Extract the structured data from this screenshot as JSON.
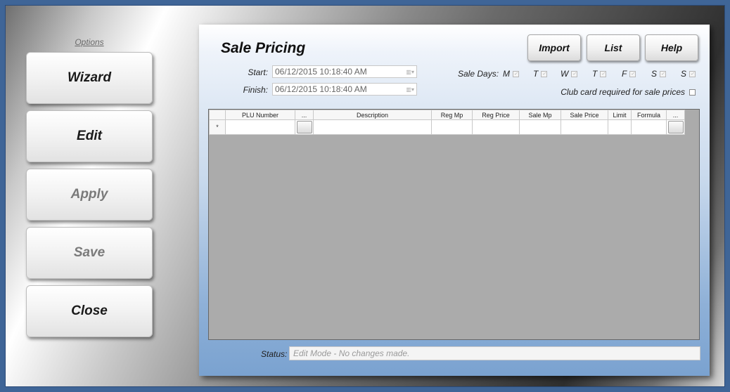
{
  "sidebar": {
    "options_label": "Options",
    "buttons": [
      {
        "label": "Wizard",
        "enabled": true
      },
      {
        "label": "Edit",
        "enabled": true
      },
      {
        "label": "Apply",
        "enabled": false
      },
      {
        "label": "Save",
        "enabled": false
      },
      {
        "label": "Close",
        "enabled": true
      }
    ]
  },
  "panel": {
    "title": "Sale Pricing",
    "toolbar": {
      "import_label": "Import",
      "list_label": "List",
      "help_label": "Help"
    },
    "start": {
      "label": "Start:",
      "value": "06/12/2015  10:18:40 AM"
    },
    "finish": {
      "label": "Finish:",
      "value": "06/12/2015  10:18:40 AM"
    },
    "sale_days": {
      "label": "Sale Days:",
      "days": [
        {
          "letter": "M",
          "checked": true
        },
        {
          "letter": "T",
          "checked": true
        },
        {
          "letter": "W",
          "checked": true
        },
        {
          "letter": "T",
          "checked": true
        },
        {
          "letter": "F",
          "checked": true
        },
        {
          "letter": "S",
          "checked": true
        },
        {
          "letter": "S",
          "checked": true
        }
      ]
    },
    "club_card": {
      "label": "Club card required for sale prices",
      "checked": false
    },
    "grid": {
      "columns": [
        "PLU Number",
        "...",
        "Description",
        "Reg Mp",
        "Reg Price",
        "Sale Mp",
        "Sale Price",
        "Limit",
        "Formula",
        "..."
      ],
      "new_row_marker": "*"
    },
    "status": {
      "label": "Status:",
      "value": "Edit Mode - No changes made."
    }
  },
  "colors": {
    "frame": "#3f6597",
    "grid_bg": "#ababab"
  }
}
